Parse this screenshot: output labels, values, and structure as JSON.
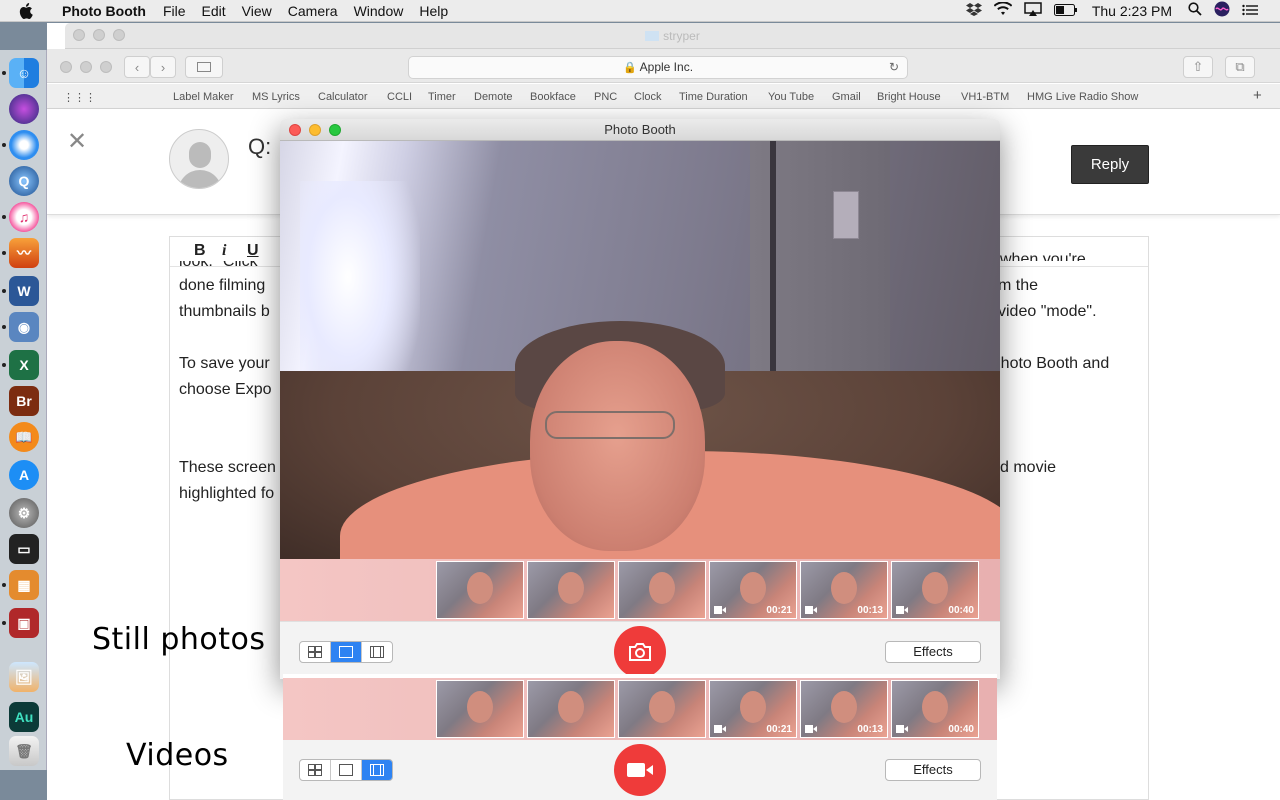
{
  "menubar": {
    "apple_icon": "apple-icon",
    "app_name": "Photo Booth",
    "items": [
      "File",
      "Edit",
      "View",
      "Camera",
      "Window",
      "Help"
    ],
    "clock": "Thu 2:23 PM",
    "status_icons": [
      "dropbox-icon",
      "wifi-icon",
      "airplay-icon",
      "battery-icon",
      "search-icon",
      "siri-icon",
      "list-icon"
    ]
  },
  "dock": {
    "apps": [
      "Finder",
      "Siri",
      "Safari",
      "QuickTime",
      "iTunes",
      "Audacity",
      "Word",
      "Screenshot",
      "Excel",
      "Bridge",
      "iBooks",
      "App Store",
      "System Preferences",
      "Printer",
      "Calculator",
      "Photo Booth",
      "Preview",
      "Audition",
      "Trash"
    ]
  },
  "safari": {
    "window_title": "stryper",
    "address": "Apple Inc.",
    "bookmarks": [
      "Label Maker",
      "MS Lyrics",
      "Calculator",
      "CCLI",
      "Timer",
      "Demote",
      "Bookface",
      "PNC",
      "Clock",
      "Time Duration",
      "You Tube",
      "Gmail",
      "Bright House",
      "VH1-BTM",
      "HMG Live Radio Show"
    ],
    "question_prefix": "Q:",
    "reply_label": "Reply",
    "format_buttons": [
      "B",
      "i",
      "U"
    ],
    "text_left": [
      "done filming",
      "thumbnails b",
      "To save your",
      "choose Expo",
      "These screen",
      "highlighted fo"
    ],
    "text_right": [
      "when you're",
      "m the",
      "video \"mode\".",
      "Photo Booth and",
      "d movie"
    ],
    "text_top_fragment": "look.\" Click"
  },
  "photobooth": {
    "title": "Photo Booth",
    "effects_label": "Effects",
    "thumbnails": [
      {
        "kind": "photo",
        "duration": ""
      },
      {
        "kind": "photo",
        "duration": ""
      },
      {
        "kind": "photo",
        "duration": ""
      },
      {
        "kind": "video",
        "duration": "00:21"
      },
      {
        "kind": "video",
        "duration": "00:13"
      },
      {
        "kind": "video",
        "duration": "00:40"
      }
    ],
    "mode_selected": "single-photo"
  },
  "video_panel": {
    "effects_label": "Effects",
    "mode_selected": "video"
  },
  "annotations": {
    "still_photos": "Still photos",
    "videos": "Videos"
  },
  "colors": {
    "shutter_red": "#ef3b3a",
    "segment_blue": "#2e83f2",
    "reply_dark": "#3a3a3a"
  }
}
